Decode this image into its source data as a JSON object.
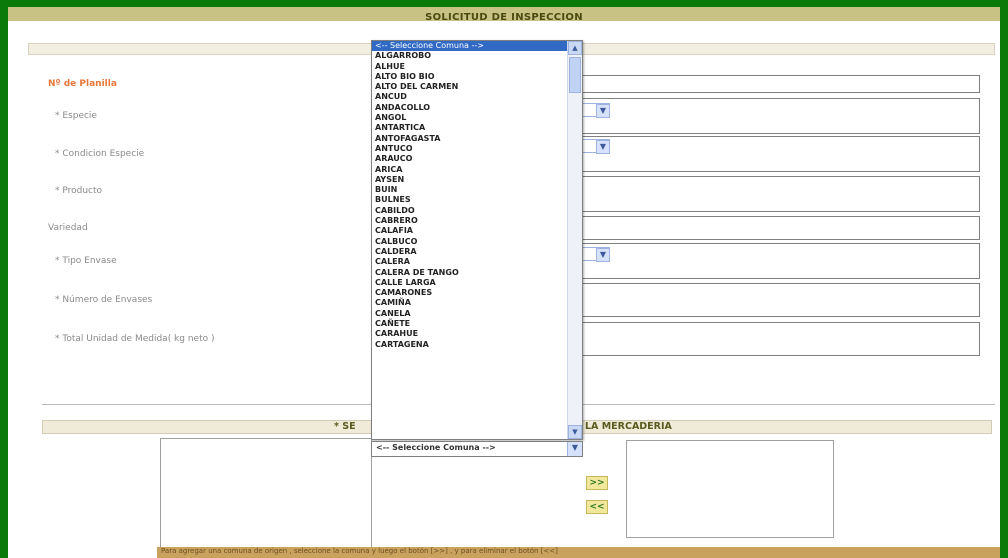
{
  "page": {
    "title": "SOLICITUD DE INSPECCION",
    "accent_color": "#0a7a0a"
  },
  "form": {
    "fields": [
      {
        "label": "Nº de Planilla",
        "required": false,
        "type": "text"
      },
      {
        "label": "* Especie",
        "required": true,
        "type": "select"
      },
      {
        "label": "* Condicion Especie",
        "required": true,
        "type": "select"
      },
      {
        "label": "* Producto",
        "required": true,
        "type": "text"
      },
      {
        "label": "Variedad",
        "required": false,
        "type": "text"
      },
      {
        "label": "* Tipo Envase",
        "required": true,
        "type": "select"
      },
      {
        "label": "* Número de Envases",
        "required": true,
        "type": "text"
      },
      {
        "label": "* Total Unidad de Medida( kg neto )",
        "required": true,
        "type": "text"
      }
    ]
  },
  "section": {
    "left_text": "* SE",
    "right_text": "LA MERCADERIA"
  },
  "buttons": {
    "add": ">>",
    "remove": "<<"
  },
  "hint": "Para agregar una comuna de origen , seleccione la comuna y luego el botón [>>] , y para eliminar el botón [<<]",
  "comuna_dropdown": {
    "selected": "<-- Seleccione Comuna -->",
    "options": [
      "<-- Seleccione Comuna -->",
      "ALGARROBO",
      "ALHUE",
      "ALTO BIO BIO",
      "ALTO DEL CARMEN",
      "ANCUD",
      "ANDACOLLO",
      "ANGOL",
      "ANTARTICA",
      "ANTOFAGASTA",
      "ANTUCO",
      "ARAUCO",
      "ARICA",
      "AYSEN",
      "BUIN",
      "BULNES",
      "CABILDO",
      "CABRERO",
      "CALAFIA",
      "CALBUCO",
      "CALDERA",
      "CALERA",
      "CALERA DE TANGO",
      "CALLE LARGA",
      "CAMARONES",
      "CAMIÑA",
      "CANELA",
      "CAÑETE",
      "CARAHUE",
      "CARTAGENA"
    ]
  },
  "icons": {
    "select_arrow": "chevron-down-icon",
    "scroll_up": "chevron-up-icon",
    "scroll_down": "chevron-down-icon"
  }
}
